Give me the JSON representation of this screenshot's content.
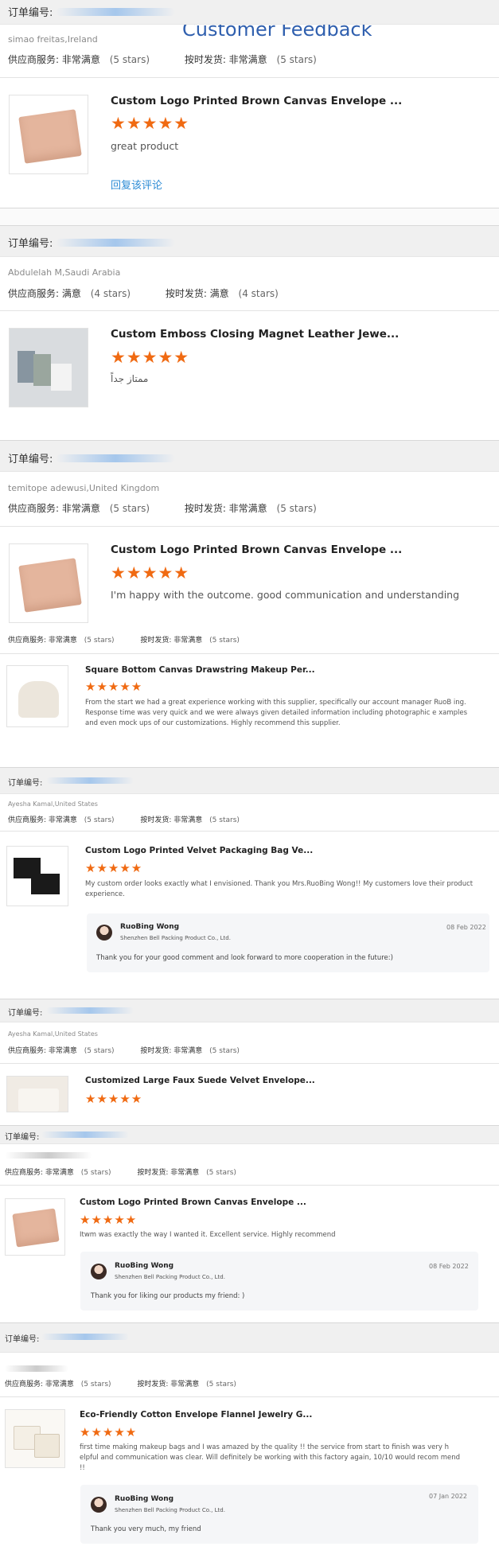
{
  "page": {
    "title": "Customer Feedback",
    "order_label": "订单编号:"
  },
  "reviews": [
    {
      "buyer": "simao freitas,Ireland",
      "supplier_service": "供应商服务: 非常满意",
      "supplier_stars": "(5 stars)",
      "on_time": "按时发货: 非常满意",
      "on_time_stars": "(5 stars)",
      "product": "Custom Logo Printed Brown Canvas Envelope ...",
      "stars": "★★★★★",
      "comment": "great product",
      "reply_link": "回复该评论"
    },
    {
      "buyer": "Abdulelah M,Saudi Arabia",
      "supplier_service": "供应商服务: 满意",
      "supplier_stars": "(4 stars)",
      "on_time": "按时发货: 满意",
      "on_time_stars": "(4 stars)",
      "product": "Custom Emboss Closing Magnet Leather Jewe...",
      "stars": "★★★★★",
      "comment": "ممتاز جداً"
    },
    {
      "buyer": "temitope adewusi,United Kingdom",
      "supplier_service": "供应商服务: 非常满意",
      "supplier_stars": "(5 stars)",
      "on_time": "按时发货: 非常满意",
      "on_time_stars": "(5 stars)",
      "product": "Custom Logo Printed Brown Canvas Envelope ...",
      "stars": "★★★★★",
      "comment": "I'm happy with the outcome. good communication and understanding",
      "supplier_service_2": "供应商服务: 非常满意",
      "supplier_stars_2": "(5 stars)",
      "on_time_2": "按时发货: 非常满意",
      "on_time_stars_2": "(5 stars)",
      "product_2": "Square Bottom Canvas Drawstring Makeup Per...",
      "stars_2": "★★★★★",
      "comment_2": "From the start we had a great experience working with this supplier, specifically our account manager RuoB ing. Response time was very quick and we were always given detailed information including photographic e xamples and even mock ups of our customizations.  Highly recommend this supplier."
    },
    {
      "buyer": "Ayesha Kamal,United States",
      "supplier_service": "供应商服务: 非常满意",
      "supplier_stars": "(5 stars)",
      "on_time": "按时发货: 非常满意",
      "on_time_stars": "(5 stars)",
      "product": "Custom Logo Printed Velvet Packaging Bag Ve...",
      "stars": "★★★★★",
      "comment": "My custom order looks exactly what I envisioned. Thank you Mrs.RuoBing Wong!! My customers love their product experience.",
      "reply": {
        "name": "RuoBing Wong",
        "company": "Shenzhen Bell Packing Product Co., Ltd.",
        "date": "08 Feb 2022",
        "text": "Thank you for your good comment and look forward to more cooperation in the future:)"
      }
    },
    {
      "buyer": "Ayesha Kamal,United States",
      "supplier_service": "供应商服务: 非常满意",
      "supplier_stars": "(5 stars)",
      "on_time": "按时发货: 非常满意",
      "on_time_stars": "(5 stars)",
      "product": "Customized Large Faux Suede Velvet Envelope...",
      "stars": "★★★★★"
    },
    {
      "supplier_service": "供应商服务: 非常满意",
      "supplier_stars": "(5 stars)",
      "on_time": "按时发货: 非常满意",
      "on_time_stars": "(5 stars)",
      "product": "Custom Logo Printed Brown Canvas Envelope ...",
      "stars": "★★★★★",
      "comment": "Itwm was exactly the way I wanted it. Excellent service. Highly recommend",
      "reply": {
        "name": "RuoBing Wong",
        "company": "Shenzhen Bell Packing Product Co., Ltd.",
        "date": "08 Feb 2022",
        "text": "Thank you for liking our products my friend: )"
      }
    },
    {
      "supplier_service": "供应商服务: 非常满意",
      "supplier_stars": "(5 stars)",
      "on_time": "按时发货: 非常满意",
      "on_time_stars": "(5 stars)",
      "product": "Eco-Friendly Cotton Envelope Flannel Jewelry G...",
      "stars": "★★★★★",
      "comment": "first time making makeup bags and I was amazed by the quality !! the service from start to finish was very h elpful and communication was clear. Will definitely be working with this factory again, 10/10 would recom mend !!",
      "reply": {
        "name": "RuoBing Wong",
        "company": "Shenzhen Bell Packing Product Co., Ltd.",
        "date": "07 Jan 2022",
        "text": "Thank you very much, my friend"
      }
    }
  ]
}
